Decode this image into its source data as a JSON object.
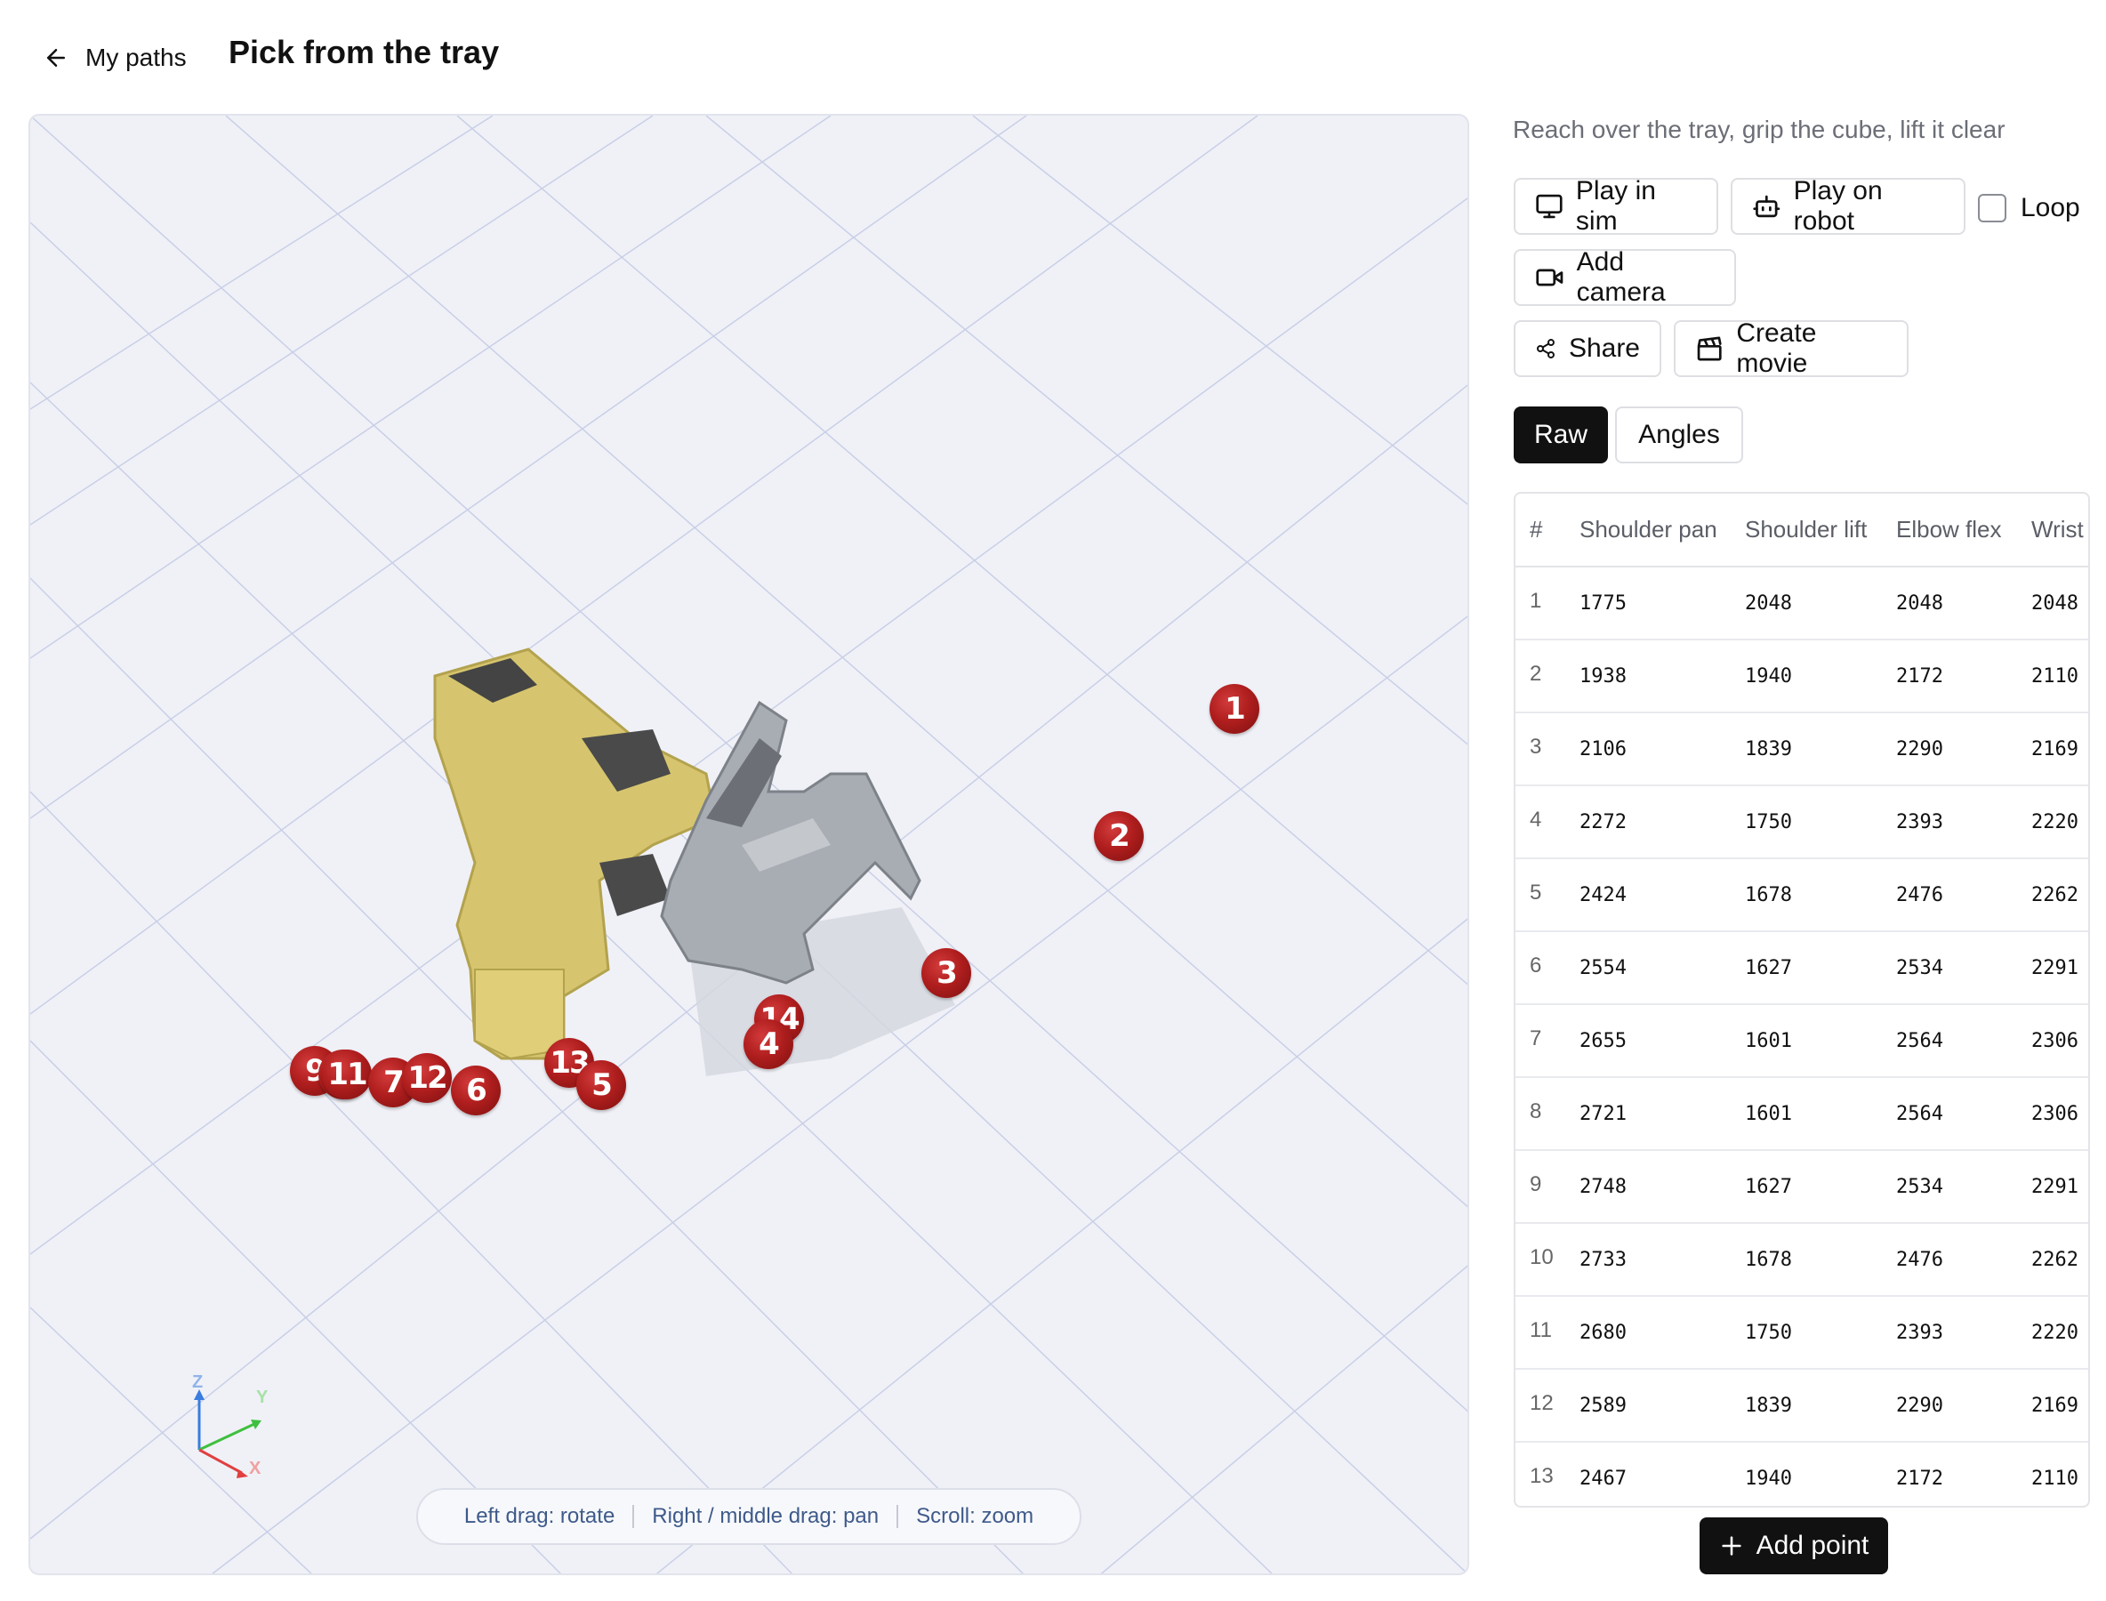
{
  "header": {
    "back_label": "My paths",
    "title": "Pick from the tray"
  },
  "viewport": {
    "markers": [
      "1",
      "2",
      "3",
      "14",
      "4",
      "13",
      "5",
      "9",
      "8",
      "11",
      "7",
      "12",
      "6"
    ],
    "hints": [
      "Left drag: rotate",
      "Right / middle drag: pan",
      "Scroll: zoom"
    ],
    "axes": {
      "z": "Z",
      "y": "Y",
      "x": "X"
    },
    "colors": {
      "robot": "#d8c870",
      "gripper": "#a9adb3",
      "marker": "#b01e1e",
      "grid": "#c8cee8"
    }
  },
  "panel": {
    "description": "Reach over the tray, grip the cube, lift it clear",
    "buttons": {
      "play_sim": "Play in sim",
      "play_robot": "Play on robot",
      "loop": "Loop",
      "add_camera": "Add camera",
      "share": "Share",
      "create_movie": "Create movie"
    },
    "tabs": {
      "raw": "Raw",
      "angles": "Angles"
    },
    "table": {
      "headers": [
        "#",
        "Shoulder pan",
        "Shoulder lift",
        "Elbow flex",
        "Wrist"
      ],
      "rows": [
        [
          "1",
          "1775",
          "2048",
          "2048",
          "2048"
        ],
        [
          "2",
          "1938",
          "1940",
          "2172",
          "2110"
        ],
        [
          "3",
          "2106",
          "1839",
          "2290",
          "2169"
        ],
        [
          "4",
          "2272",
          "1750",
          "2393",
          "2220"
        ],
        [
          "5",
          "2424",
          "1678",
          "2476",
          "2262"
        ],
        [
          "6",
          "2554",
          "1627",
          "2534",
          "2291"
        ],
        [
          "7",
          "2655",
          "1601",
          "2564",
          "2306"
        ],
        [
          "8",
          "2721",
          "1601",
          "2564",
          "2306"
        ],
        [
          "9",
          "2748",
          "1627",
          "2534",
          "2291"
        ],
        [
          "10",
          "2733",
          "1678",
          "2476",
          "2262"
        ],
        [
          "11",
          "2680",
          "1750",
          "2393",
          "2220"
        ],
        [
          "12",
          "2589",
          "1839",
          "2290",
          "2169"
        ],
        [
          "13",
          "2467",
          "1940",
          "2172",
          "2110"
        ]
      ]
    },
    "add_point": "Add point"
  }
}
